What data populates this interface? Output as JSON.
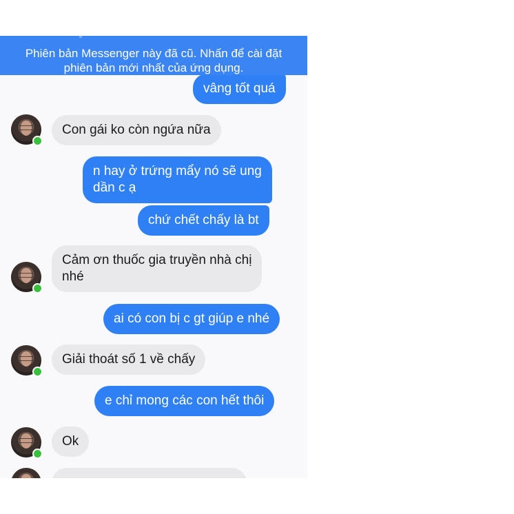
{
  "banner": {
    "line1": "Phiên bản Messenger này đã cũ. Nhấn để cài đặt",
    "line2": "phiên bản mới nhất của ứng dụng."
  },
  "messages": [
    {
      "direction": "outgoing",
      "text": "vâng  tốt  quá"
    },
    {
      "direction": "incoming",
      "text": "Con gái ko còn ngứa nữa"
    },
    {
      "direction": "outgoing",
      "lines": [
        "n hay ở trứng  mẩy nó sẽ  ung",
        "dần  c ạ"
      ]
    },
    {
      "direction": "outgoing",
      "text": "chứ  chết  chấy  là  bt"
    },
    {
      "direction": "incoming",
      "lines": [
        "Cảm ơn thuốc gia truyền nhà chị",
        "nhé"
      ]
    },
    {
      "direction": "outgoing",
      "text": "ai có con bị c gt giúp  e nhé"
    },
    {
      "direction": "incoming",
      "text": "Giải thoát số 1 về chấy"
    },
    {
      "direction": "outgoing",
      "text": "e chỉ mong các  con hết  thôi"
    },
    {
      "direction": "incoming",
      "text": "Ok"
    }
  ],
  "colors": {
    "banner": "#3b84f4",
    "outgoing_bubble": "#2f7ff5",
    "incoming_bubble": "#e9e9eb",
    "online_dot": "#39c13d"
  },
  "icons": {
    "avatar": "avatar",
    "online_status": "online-status-icon"
  }
}
